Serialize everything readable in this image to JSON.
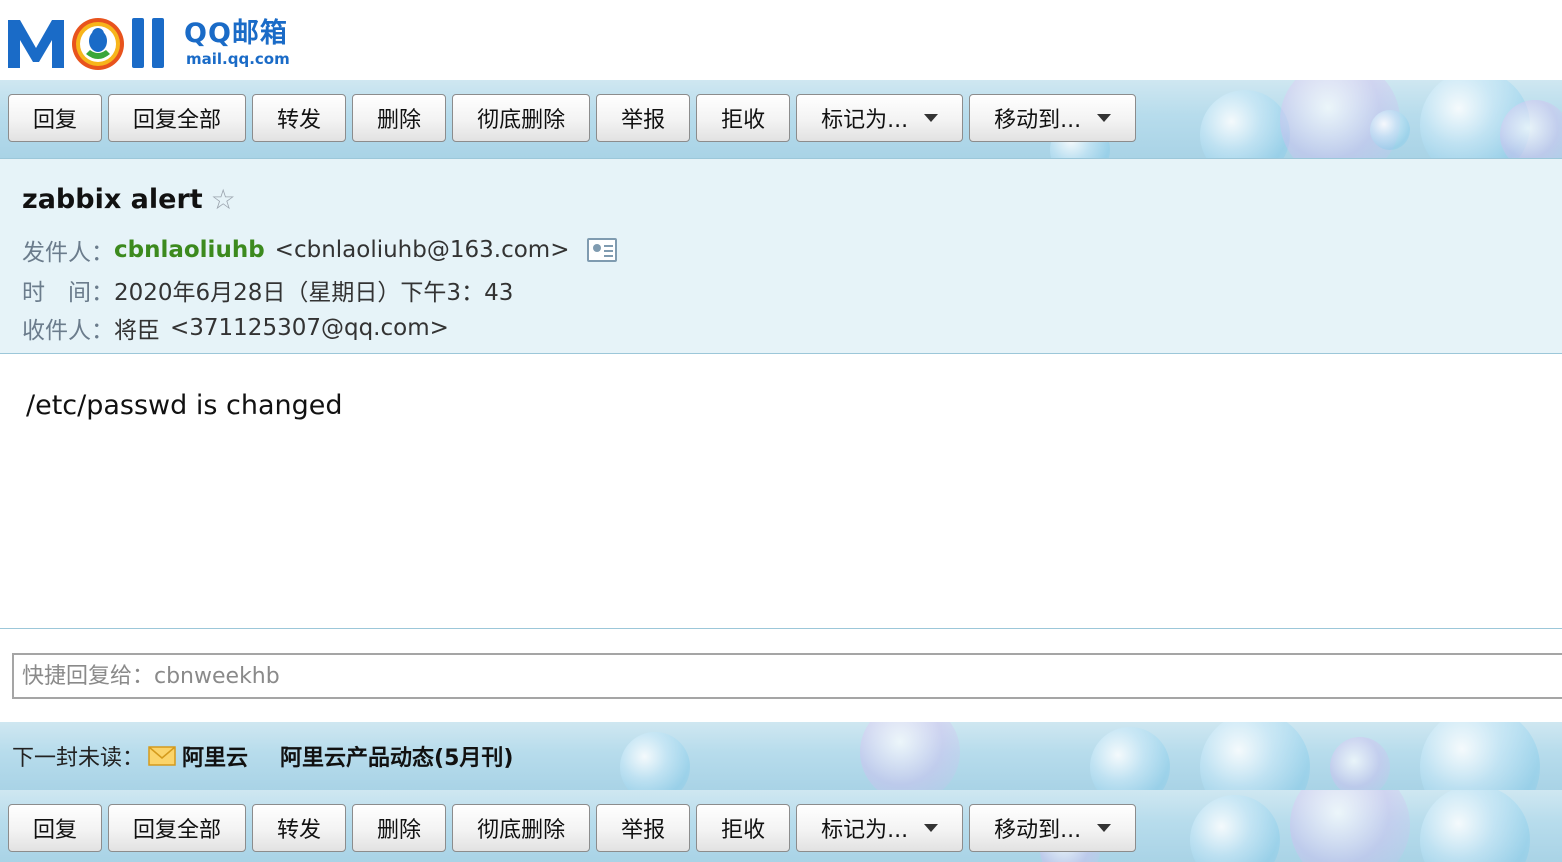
{
  "logo": {
    "cn": "QQ邮箱",
    "url": "mail.qq.com"
  },
  "toolbar": {
    "buttons": [
      "回复",
      "回复全部",
      "转发",
      "删除",
      "彻底删除",
      "举报",
      "拒收",
      "标记为...",
      "移动到..."
    ]
  },
  "mail": {
    "subject": "zabbix alert",
    "star": "☆",
    "from_label": "发件人：",
    "from_name": "cbnlaoliuhb",
    "from_email": "<cbnlaoliuhb@163.com>",
    "time_label": "时　间：",
    "time_value": "2020年6月28日（星期日）下午3：43",
    "to_label": "收件人：",
    "to_name": "将臣",
    "to_email": "<371125307@qq.com>",
    "body": "/etc/passwd is changed"
  },
  "quick_reply": {
    "placeholder": "快捷回复给：cbnweekhb"
  },
  "next_unread": {
    "label": "下一封未读：",
    "sender": "阿里云",
    "subject": "阿里云产品动态(5月刊)"
  },
  "colors": {
    "sender_green": "#3c8a1e",
    "logo_blue": "#1a6bc7",
    "header_bg": "#e6f3f8"
  }
}
